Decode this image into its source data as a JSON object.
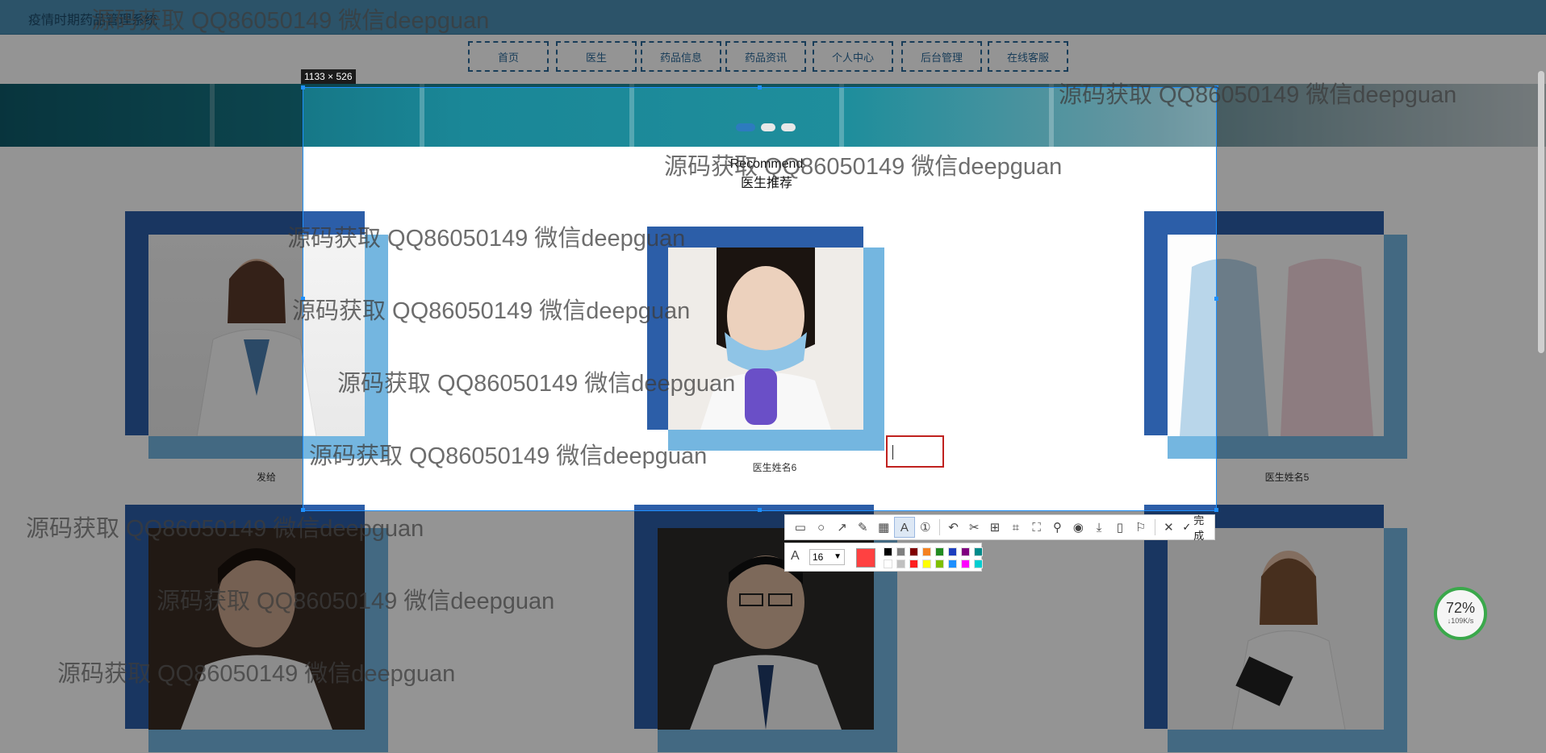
{
  "site": {
    "title": "疫情时期药品管理系统"
  },
  "nav": {
    "items": [
      {
        "label": "首页"
      },
      {
        "label": "医生"
      },
      {
        "label": "药品信息"
      },
      {
        "label": "药品资讯"
      },
      {
        "label": "个人中心"
      },
      {
        "label": "后台管理"
      },
      {
        "label": "在线客服"
      }
    ]
  },
  "section": {
    "title_en": "Recommend",
    "title_cn": "医生推荐"
  },
  "doctors": [
    {
      "name": "发给"
    },
    {
      "name": "医生姓名6"
    },
    {
      "name": "医生姓名5"
    },
    {
      "name": ""
    },
    {
      "name": ""
    },
    {
      "name": ""
    }
  ],
  "screenshot_tool": {
    "size_label": "1133 × 526",
    "done_label": "完成",
    "font_size": "16",
    "current_color": "#ff4141",
    "palette": [
      "#000000",
      "#808080",
      "#800000",
      "#f58220",
      "#228b22",
      "#1e3fbf",
      "#800080",
      "#008b8b",
      "#ffffff",
      "#c0c0c0",
      "#ff2020",
      "#ffff00",
      "#7fbf00",
      "#1e90ff",
      "#ff00ff",
      "#00ced1"
    ],
    "tools": [
      "rect-icon",
      "circle-icon",
      "arrow-icon",
      "pen-icon",
      "mosaic-icon",
      "text-icon",
      "number-icon",
      "undo-icon",
      "cut-icon",
      "ocr-icon",
      "scan-icon",
      "crop-icon",
      "pin-icon",
      "record-icon",
      "save-icon",
      "phone-icon",
      "bookmark-icon",
      "close-icon",
      "check-icon"
    ]
  },
  "network_gadget": {
    "percent": "72%",
    "speed": "↓109K/s"
  },
  "watermark": "源码获取 QQ86050149 微信deepguan"
}
